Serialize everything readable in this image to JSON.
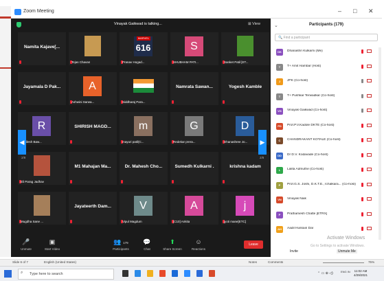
{
  "window": {
    "title": "Zoom Meeting",
    "controls": [
      "–",
      "□",
      "✕"
    ]
  },
  "meeting": {
    "talking": "Vinayak Gaikwad is talking...",
    "view": "View"
  },
  "tiles": [
    {
      "name": "Namita Kajave[...",
      "type": "text"
    },
    {
      "name": "Tejas Chavan",
      "type": "photo",
      "color": "#c79a52"
    },
    {
      "name": "Pranav Hogad...",
      "type": "marvel",
      "big": "616",
      "brand": "MARVEL"
    },
    {
      "name": "SHUBHAM PATI...",
      "type": "letter",
      "letter": "S",
      "color": "#d64a78"
    },
    {
      "name": "Sanket Patil [ET...",
      "type": "photo",
      "color": "#4a8f2e"
    },
    {
      "name": "Jayamala D Pak...",
      "type": "text"
    },
    {
      "name": "Ashwini Sarwa...",
      "type": "letter",
      "letter": "A",
      "color": "#e8622a"
    },
    {
      "name": "Siddharaj Para...",
      "type": "flag"
    },
    {
      "name": "Namrata Sawan...",
      "type": "text"
    },
    {
      "name": "Yogesh Kamble",
      "type": "text"
    },
    {
      "name": "Abhilesh Baw...",
      "type": "letter",
      "letter": "R",
      "color": "#6a4fa8"
    },
    {
      "name": "SHIRISH MAGD...",
      "type": "text"
    },
    {
      "name": "mayuri patil(C...",
      "type": "letter",
      "letter": "m",
      "color": "#8a7060"
    },
    {
      "name": "Redekar prera...",
      "type": "letter",
      "letter": "G",
      "color": "#7a7a7a"
    },
    {
      "name": "Dhanashree Jo...",
      "type": "letter",
      "letter": "D",
      "color": "#2a5c9a"
    },
    {
      "name": "Eli Parag Jadhav",
      "type": "photo",
      "color": "#b5533d"
    },
    {
      "name": "M1 Mahajan Ma...",
      "type": "text"
    },
    {
      "name": "Dr. Mahesh Cho...",
      "type": "text"
    },
    {
      "name": "Sumedh Kulkarni .",
      "type": "text"
    },
    {
      "name": "krishna kadam",
      "type": "text"
    },
    {
      "name": "Mugdha Sane ...",
      "type": "photo",
      "color": "#a57f5a"
    },
    {
      "name": "Jayateerth Dam...",
      "type": "text"
    },
    {
      "name": "Vipul Magdum",
      "type": "letter",
      "letter": "V",
      "color": "#6e8a8a"
    },
    {
      "name": "[C10] Ankita",
      "type": "letter",
      "letter": "A",
      "color": "#d64a9a"
    },
    {
      "name": "jyoti mane[ETC]",
      "type": "letter",
      "letter": "j",
      "color": "#d64ab8"
    }
  ],
  "pager": {
    "left": "2/8",
    "right": "2/8"
  },
  "controls": [
    {
      "label": "Unmute",
      "icon": "🎤"
    },
    {
      "label": "Start Video",
      "icon": "▣"
    },
    {
      "label": "Participants",
      "icon": "👥",
      "count": "179"
    },
    {
      "label": "Chat",
      "icon": "💬"
    },
    {
      "label": "Share Screen",
      "icon": "⬆",
      "accent": "#23d959"
    },
    {
      "label": "Reactions",
      "icon": "☺"
    }
  ],
  "leave": "Leave",
  "panel": {
    "title": "Participants (179)",
    "find_placeholder": "Find a participant",
    "participants": [
      {
        "initials": "DK",
        "name": "Dhanashri Kulkarni (Me)",
        "color": "#8a4fbf",
        "muted": true
      },
      {
        "initials": "T",
        "name": "T+ Amit Hambar (Host)",
        "color": "#888",
        "muted": true
      },
      {
        "initials": "J",
        "name": "JPK (Co-host)",
        "color": "#f09a1a",
        "muted": false
      },
      {
        "initials": "T",
        "name": "T+ Pushkar Terwadkar (Co-host)",
        "color": "#888",
        "muted": false
      },
      {
        "initials": "VG",
        "name": "Vinayak Gaikwad (Co-host)",
        "color": "#8a4fbf",
        "muted": false
      },
      {
        "initials": "PD",
        "name": "Prof.P.V.Kadole DKTE (Co-host)",
        "color": "#d64a2a",
        "muted": true
      },
      {
        "initials": "C",
        "name": "CHANDRAKANT KOTALE (Co-host)",
        "color": "#7a4a2a",
        "muted": true
      },
      {
        "initials": "DD",
        "name": "Dr D.V. Kodavade (Co-host)",
        "color": "#3a6ac8",
        "muted": true
      },
      {
        "initials": "L",
        "name": "Lalita Admuthe (Co-host)",
        "color": "#2ea84a",
        "muted": true
      },
      {
        "initials": "P",
        "name": "Prof.G.S. Joshi, D.K.T.E., Ichalkara... (Co-host)",
        "color": "#a0a040",
        "muted": true
      },
      {
        "initials": "VN",
        "name": "Vinayak Naik",
        "color": "#d64a2a",
        "muted": true
      },
      {
        "initials": "P",
        "name": "Prathamesh Chatte [ETRX]",
        "color": "#8a4fbf",
        "muted": true
      },
      {
        "initials": "AH",
        "name": "Aadil Hussain Dar",
        "color": "#f0a01a",
        "muted": true
      }
    ],
    "invite": "Invite",
    "unmute_me": "Unmute Me",
    "activate": "Activate Windows",
    "activate_sub": "Go to Settings to activate Windows."
  },
  "statusbar": {
    "slide": "Slide 6 of 7",
    "lang": "English (United States)",
    "notes": "Notes",
    "comments": "Comments",
    "zoom": "75%"
  },
  "taskbar": {
    "search": "Type here to search",
    "time": "11:02 AM",
    "date": "4/29/2021",
    "lang": "ENG IN"
  }
}
